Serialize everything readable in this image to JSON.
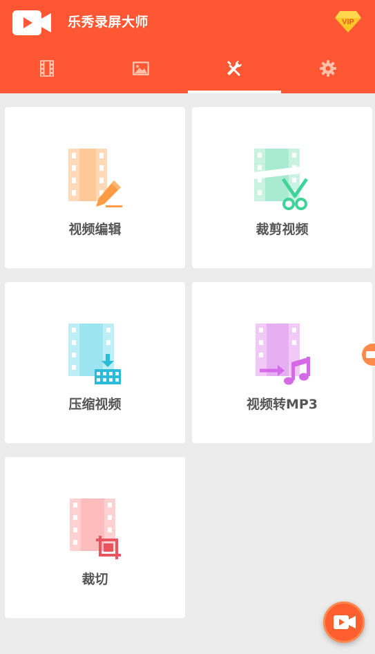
{
  "app": {
    "title": "乐秀录屏大师",
    "vip_badge": "VIP",
    "accent_color": "#ff5733"
  },
  "tabs": [
    {
      "name": "videos-tab",
      "icon": "film-icon",
      "active": false
    },
    {
      "name": "images-tab",
      "icon": "image-icon",
      "active": false
    },
    {
      "name": "tools-tab",
      "icon": "tools-icon",
      "active": true
    },
    {
      "name": "settings-tab",
      "icon": "gear-icon",
      "active": false
    }
  ],
  "tools": [
    {
      "label": "视频编辑",
      "icon": "video-edit-icon"
    },
    {
      "label": "裁剪视频",
      "icon": "video-trim-icon"
    },
    {
      "label": "压缩视频",
      "icon": "video-compress-icon"
    },
    {
      "label": "视频转MP3",
      "icon": "video-to-mp3-icon"
    },
    {
      "label": "裁切",
      "icon": "video-crop-icon"
    }
  ],
  "fab": {
    "icon": "record-camera-icon"
  }
}
